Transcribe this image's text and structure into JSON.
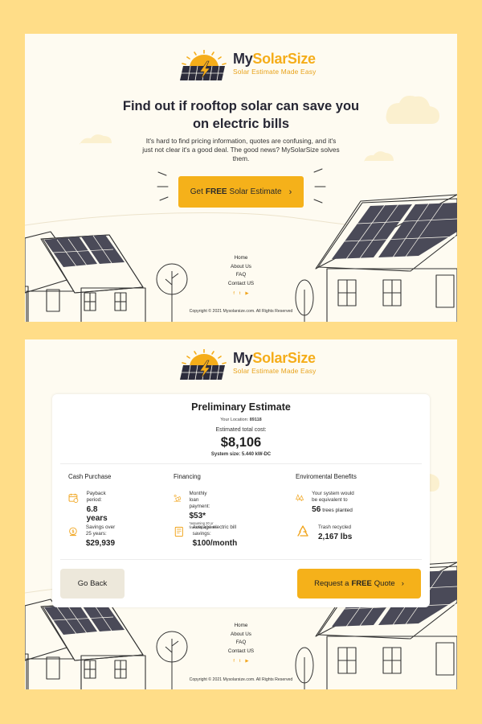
{
  "brand": {
    "name_part1": "My",
    "name_part2": "SolarSize",
    "tagline": "Solar Estimate Made Easy",
    "colors": {
      "accent": "#f5b11a",
      "dark": "#2c2c3c",
      "page_bg": "#ffdd88",
      "panel_bg": "#fefbf1"
    }
  },
  "landing": {
    "headline_line1": "Find out if rooftop solar can save you",
    "headline_line2": "on electric bills",
    "body": "It's hard to find pricing information, quotes are confusing, and it's just not clear it's a good deal. The good news? MySolarSize solves them.",
    "cta": {
      "prefix": "Get",
      "emphasis": "FREE",
      "suffix": "Solar Estimate",
      "icon": "chevron-right-icon"
    }
  },
  "footer": {
    "links": [
      "Home",
      "About Us",
      "FAQ",
      "Contact US"
    ],
    "social_icons": [
      "facebook-icon",
      "twitter-icon",
      "youtube-icon"
    ],
    "copyright": "Copyright © 2021 Mysolarsize.com. All Rights Reserved"
  },
  "estimate": {
    "title": "Preliminary Estimate",
    "location_label": "Your Location:",
    "location_value": "89118",
    "cost_label": "Estimated total cost:",
    "cost_value": "$8,106",
    "system_label": "System size:",
    "system_value": "5.440 kW-DC",
    "columns": [
      {
        "heading": "Cash Purchase",
        "metrics": [
          {
            "icon": "calendar-icon",
            "label": "Payback period:",
            "value": "6.8 years"
          },
          {
            "icon": "dollar-coin-icon",
            "label": "Savings over 25 years:",
            "value": "$29,939"
          }
        ]
      },
      {
        "heading": "Financing",
        "metrics": [
          {
            "icon": "solar-panel-icon",
            "label": "Monthly loan payment:",
            "value": "$53*",
            "note": "*assuming 20 yr financing at 4.99%"
          },
          {
            "icon": "bill-icon",
            "label": "Average electric bill savings:",
            "value": "$100/month"
          }
        ]
      },
      {
        "heading": "Enviromental Benefits",
        "metrics": [
          {
            "icon": "trees-icon",
            "label": "Your system would be equivalent to",
            "value": "56",
            "suffix": "trees planted"
          },
          {
            "icon": "recycle-icon",
            "label": "Trash recycled",
            "value": "2,167 lbs"
          }
        ]
      }
    ],
    "back_label": "Go Back",
    "quote": {
      "prefix": "Request a",
      "emphasis": "FREE",
      "suffix": "Quote",
      "icon": "chevron-right-icon"
    }
  }
}
